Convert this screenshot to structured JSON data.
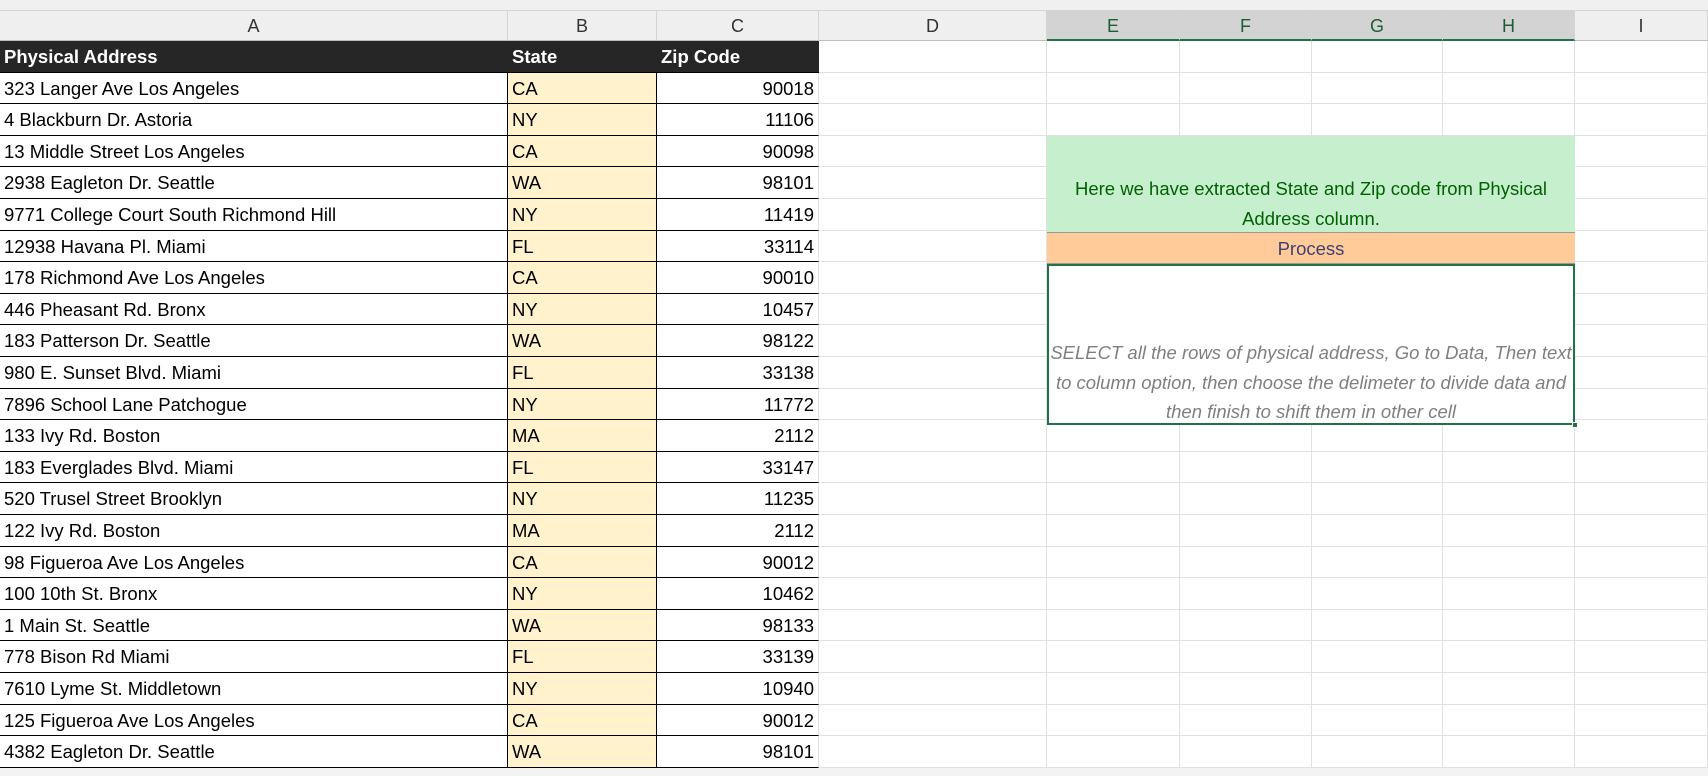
{
  "columns": [
    "A",
    "B",
    "C",
    "D",
    "E",
    "F",
    "G",
    "H",
    "I"
  ],
  "table": {
    "headers": [
      "Physical Address",
      "State",
      "Zip Code"
    ],
    "rows": [
      [
        "323 Langer Ave Los Angeles",
        "CA",
        "90018"
      ],
      [
        "4 Blackburn Dr. Astoria",
        "NY",
        "11106"
      ],
      [
        "13 Middle Street Los Angeles",
        "CA",
        "90098"
      ],
      [
        "2938 Eagleton Dr. Seattle",
        "WA",
        "98101"
      ],
      [
        "9771 College Court South Richmond Hill",
        "NY",
        "11419"
      ],
      [
        "12938 Havana Pl. Miami",
        "FL",
        "33114"
      ],
      [
        "178 Richmond Ave Los Angeles",
        "CA",
        "90010"
      ],
      [
        "446 Pheasant Rd. Bronx",
        "NY",
        "10457"
      ],
      [
        "183 Patterson Dr. Seattle",
        "WA",
        "98122"
      ],
      [
        "980 E. Sunset Blvd. Miami",
        "FL",
        "33138"
      ],
      [
        "7896 School Lane Patchogue",
        "NY",
        "11772"
      ],
      [
        "133 Ivy Rd. Boston",
        "MA",
        "2112"
      ],
      [
        "183 Everglades Blvd. Miami",
        "FL",
        "33147"
      ],
      [
        "520 Trusel Street Brooklyn",
        "NY",
        "11235"
      ],
      [
        "122 Ivy Rd. Boston",
        "MA",
        "2112"
      ],
      [
        "98 Figueroa Ave Los Angeles",
        "CA",
        "90012"
      ],
      [
        "100 10th St. Bronx",
        "NY",
        "10462"
      ],
      [
        "1 Main St. Seattle",
        "WA",
        "98133"
      ],
      [
        "778 Bison Rd Miami",
        "FL",
        "33139"
      ],
      [
        "7610 Lyme St. Middletown",
        "NY",
        "10940"
      ],
      [
        "125 Figueroa Ave Los Angeles",
        "CA",
        "90012"
      ],
      [
        "4382 Eagleton Dr. Seattle",
        "WA",
        "98101"
      ]
    ]
  },
  "notes": {
    "summary": "Here we have extracted State and Zip code from Physical Address column.",
    "process_label": "Process",
    "instructions": "SELECT all the rows of physical address, Go to Data, Then text to column option, then choose the delimeter to divide data and then finish to shift them in other cell"
  },
  "colors": {
    "header_bg": "#262626",
    "state_fill": "#fff2cc",
    "summary_fill": "#c6efce",
    "process_fill": "#ffcc99",
    "selection": "#217346"
  }
}
